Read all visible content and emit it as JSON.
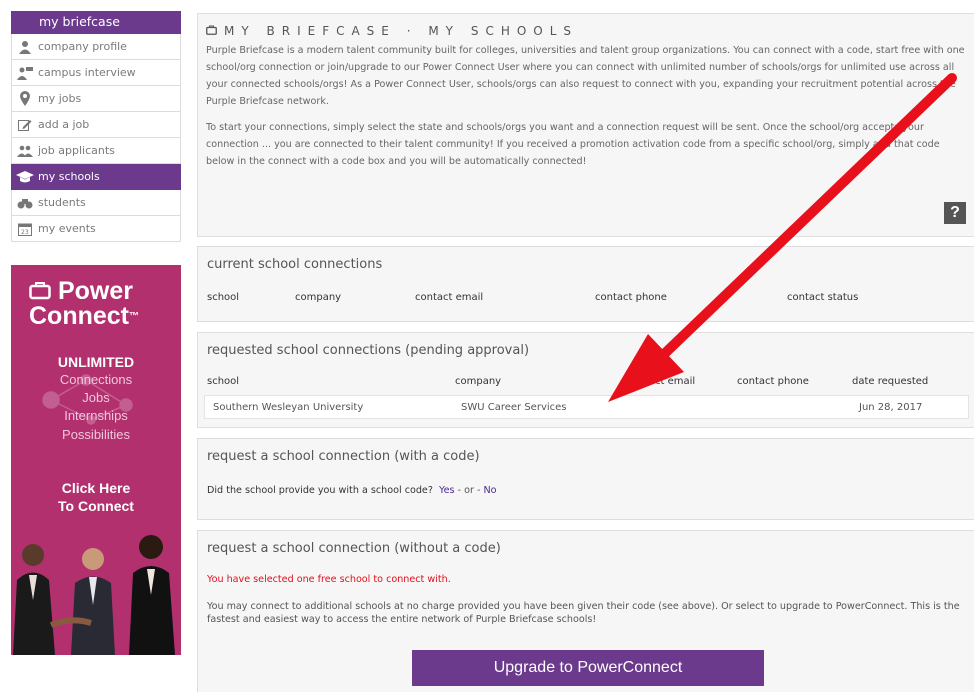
{
  "sidebar": {
    "header": "my briefcase",
    "items": [
      {
        "label": "company profile",
        "icon": "person-icon"
      },
      {
        "label": "campus interview",
        "icon": "interview-icon"
      },
      {
        "label": "my jobs",
        "icon": "location-pin-icon"
      },
      {
        "label": "add a job",
        "icon": "edit-icon"
      },
      {
        "label": "job applicants",
        "icon": "group-icon"
      },
      {
        "label": "my schools",
        "icon": "graduation-cap-icon",
        "active": true
      },
      {
        "label": "students",
        "icon": "binoculars-icon"
      },
      {
        "label": "my events",
        "icon": "calendar-icon"
      }
    ]
  },
  "promo": {
    "title_line1": "Power",
    "title_line2": "Connect",
    "trademark": "™",
    "unlimited": "UNLIMITED",
    "features": [
      "Connections",
      "Jobs",
      "Internships",
      "Possibilities"
    ],
    "click_line1": "Click Here",
    "click_line2": "To Connect"
  },
  "intro": {
    "title": "MY BRIEFCASE · MY SCHOOLS",
    "para1": "Purple Briefcase is a modern talent community built for colleges, universities and talent group organizations. You can connect with a code, start free with one school/org connection or join/upgrade to our Power Connect User where you can connect with unlimited number of schools/orgs for unlimited use across all your connected schools/orgs! As a Power Connect User, schools/orgs can also request to connect with you, expanding your recruitment potential across the Purple Briefcase network.",
    "para2": "To start your connections, simply select the state and schools/orgs you want and a connection request will be sent. Once the school/org accepts your connection ... you are connected to their talent community! If you received a promotion activation code from a specific school/org, simply add that code below in the connect with a code box and you will be automatically connected!",
    "help_label": "?"
  },
  "current": {
    "title": "current school connections",
    "columns": [
      "school",
      "company",
      "contact email",
      "contact phone",
      "contact status"
    ]
  },
  "requested": {
    "title": "requested school connections (pending approval)",
    "columns": [
      "school",
      "company",
      "contact email",
      "contact phone",
      "date requested"
    ],
    "rows": [
      {
        "school": "Southern Wesleyan University",
        "company": "SWU Career Services",
        "email": "",
        "phone": "",
        "date": "Jun 28, 2017"
      }
    ]
  },
  "with_code": {
    "title": "request a school connection (with a code)",
    "question": "Did the school provide you with a school code?",
    "yes": "Yes",
    "or": " - or - ",
    "no": "No"
  },
  "without_code": {
    "title": "request a school connection (without a code)",
    "warning": "You have selected one free school to connect with.",
    "info": "You may connect to additional schools at no charge provided you have been given their code (see above). Or select to upgrade to PowerConnect. This is the fastest and easiest way to access the entire network of Purple Briefcase schools!",
    "button": "Upgrade to PowerConnect"
  },
  "colors": {
    "purple": "#6b3a8c",
    "promo_pink": "#b2306e",
    "arrow_red": "#e8101a",
    "warning_red": "#e0101a"
  }
}
